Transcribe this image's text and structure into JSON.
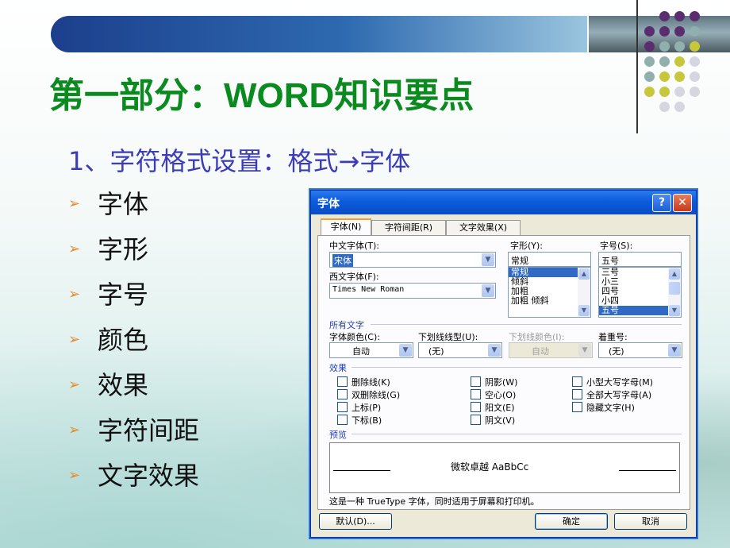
{
  "slide": {
    "title": "第一部分：WORD知识要点",
    "subtitle": "1、字符格式设置：格式→字体",
    "bullet_glyph": "➢",
    "bullets": [
      "字体",
      "字形",
      "字号",
      "颜色",
      "效果",
      "字符间距",
      "文字效果"
    ]
  },
  "colors": {
    "title": "#0b8a1f",
    "subtitle": "#3c3cb8",
    "bullet_arrow": "#e38b2a",
    "header_bar": "#1c3f8c",
    "dots": [
      "#5a2d6e",
      "#8fb0ad",
      "#c7c73a",
      "#d6d6e0"
    ]
  },
  "dialog": {
    "title": "字体",
    "help_label": "?",
    "close_label": "✕",
    "tabs": [
      "字体(N)",
      "字符间距(R)",
      "文字效果(X)"
    ],
    "active_tab": 0,
    "chinese_font": {
      "label": "中文字体(T):",
      "value": "宋体"
    },
    "western_font": {
      "label": "西文字体(F):",
      "value": "Times New Roman"
    },
    "font_style": {
      "label": "字形(Y):",
      "value": "常规",
      "options": [
        "常规",
        "倾斜",
        "加粗",
        "加粗 倾斜"
      ],
      "selected": 0
    },
    "font_size": {
      "label": "字号(S):",
      "value": "五号",
      "options": [
        "三号",
        "小三",
        "四号",
        "小四",
        "五号"
      ],
      "selected": 4
    },
    "all_text": {
      "section_label": "所有文字",
      "font_color": {
        "label": "字体颜色(C):",
        "value": "自动"
      },
      "underline_type": {
        "label": "下划线线型(U):",
        "value": "(无)"
      },
      "underline_color": {
        "label": "下划线颜色(I):",
        "value": "自动"
      },
      "emphasis": {
        "label": "着重号:",
        "value": "(无)"
      }
    },
    "effects": {
      "section_label": "效果",
      "col1": [
        {
          "label": "删除线(K)",
          "checked": false
        },
        {
          "label": "双删除线(G)",
          "checked": false
        },
        {
          "label": "上标(P)",
          "checked": false
        },
        {
          "label": "下标(B)",
          "checked": false
        }
      ],
      "col2": [
        {
          "label": "阴影(W)",
          "checked": false
        },
        {
          "label": "空心(O)",
          "checked": false
        },
        {
          "label": "阳文(E)",
          "checked": false
        },
        {
          "label": "阴文(V)",
          "checked": false
        }
      ],
      "col3": [
        {
          "label": "小型大写字母(M)",
          "checked": false
        },
        {
          "label": "全部大写字母(A)",
          "checked": false
        },
        {
          "label": "隐藏文字(H)",
          "checked": false
        }
      ]
    },
    "preview": {
      "section_label": "预览",
      "sample": "微软卓越 AaBbCc"
    },
    "note": "这是一种 TrueType 字体，同时适用于屏幕和打印机。",
    "buttons": {
      "default": "默认(D)...",
      "ok": "确定",
      "cancel": "取消"
    }
  }
}
